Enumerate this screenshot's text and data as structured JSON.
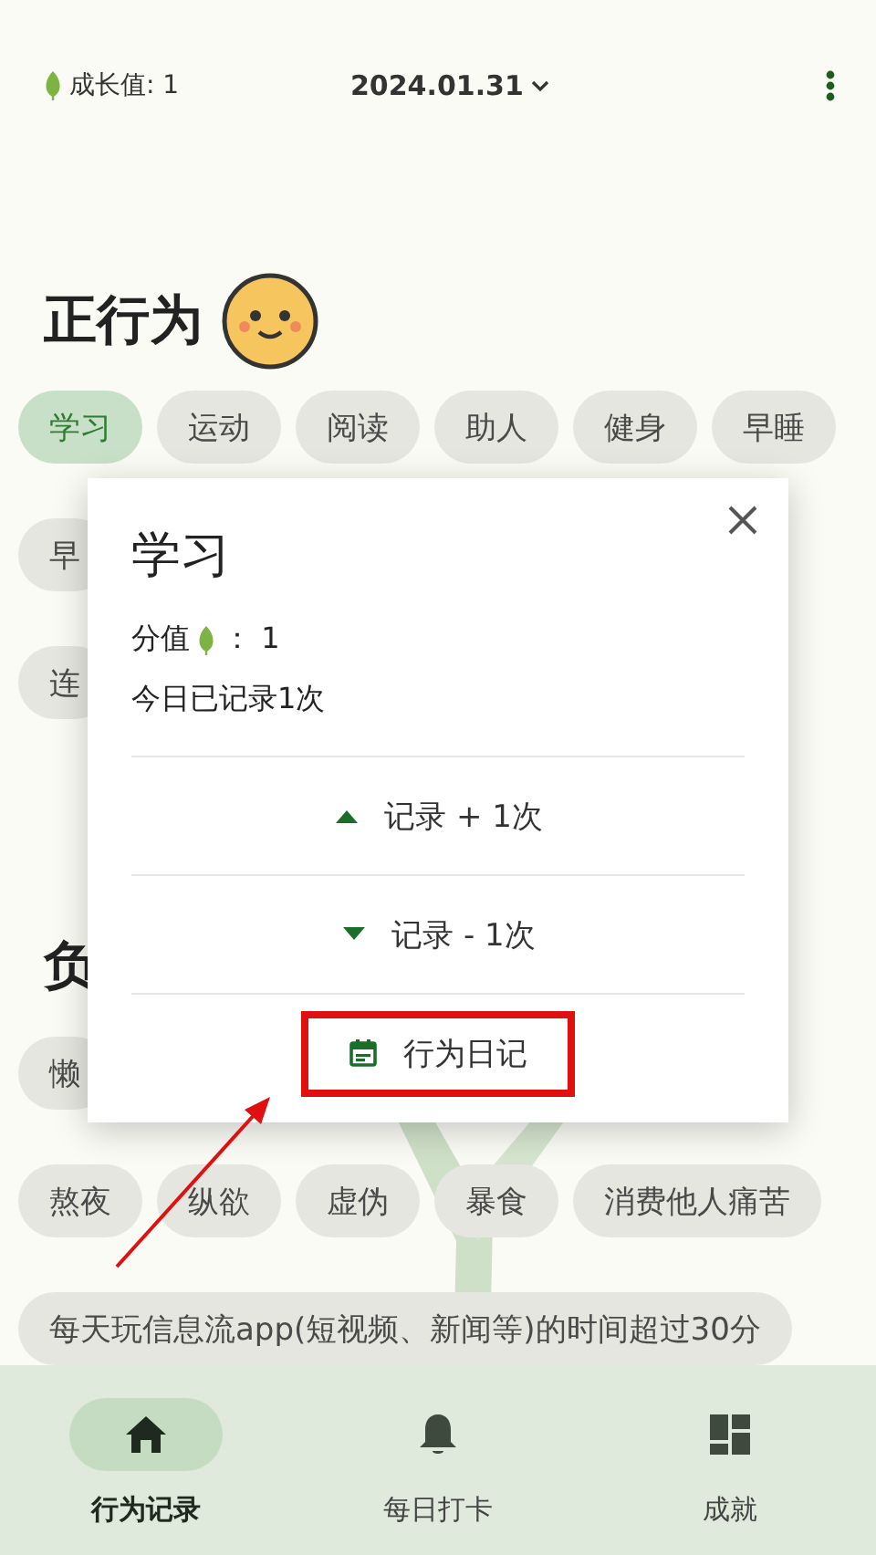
{
  "header": {
    "growth_label": "成长值: 1",
    "date": "2024.01.31"
  },
  "positive": {
    "title": "正行为",
    "rows": [
      [
        {
          "label": "学习",
          "selected": true
        },
        {
          "label": "运动",
          "selected": false
        },
        {
          "label": "阅读",
          "selected": false
        },
        {
          "label": "助人",
          "selected": false
        },
        {
          "label": "健身",
          "selected": false
        },
        {
          "label": "早睡",
          "selected": false
        }
      ],
      [
        {
          "label": "早",
          "selected": false
        }
      ],
      [
        {
          "label": "连",
          "selected": false
        }
      ]
    ]
  },
  "negative": {
    "title": "负",
    "rows": [
      [
        {
          "label": "懒",
          "selected": false
        }
      ],
      [
        {
          "label": "熬夜",
          "selected": false
        },
        {
          "label": "纵欲",
          "selected": false
        },
        {
          "label": "虚伪",
          "selected": false
        },
        {
          "label": "暴食",
          "selected": false
        },
        {
          "label": "消费他人痛苦",
          "selected": false
        }
      ],
      [
        {
          "label": "每天玩信息流app(短视频、新闻等)的时间超过30分",
          "selected": false
        }
      ]
    ]
  },
  "dialog": {
    "title": "学习",
    "score_label": "分值",
    "score_value": "： 1",
    "today": "今日已记录1次",
    "actions": [
      {
        "kind": "increment",
        "label": "记录 + 1次",
        "highlighted": false
      },
      {
        "kind": "decrement",
        "label": "记录 - 1次",
        "highlighted": false
      },
      {
        "kind": "diary",
        "label": "行为日记",
        "highlighted": true
      }
    ]
  },
  "nav": [
    {
      "kind": "home",
      "label": "行为记录",
      "selected": true
    },
    {
      "kind": "bell",
      "label": "每日打卡",
      "selected": false
    },
    {
      "kind": "dashboard",
      "label": "成就",
      "selected": false
    }
  ]
}
